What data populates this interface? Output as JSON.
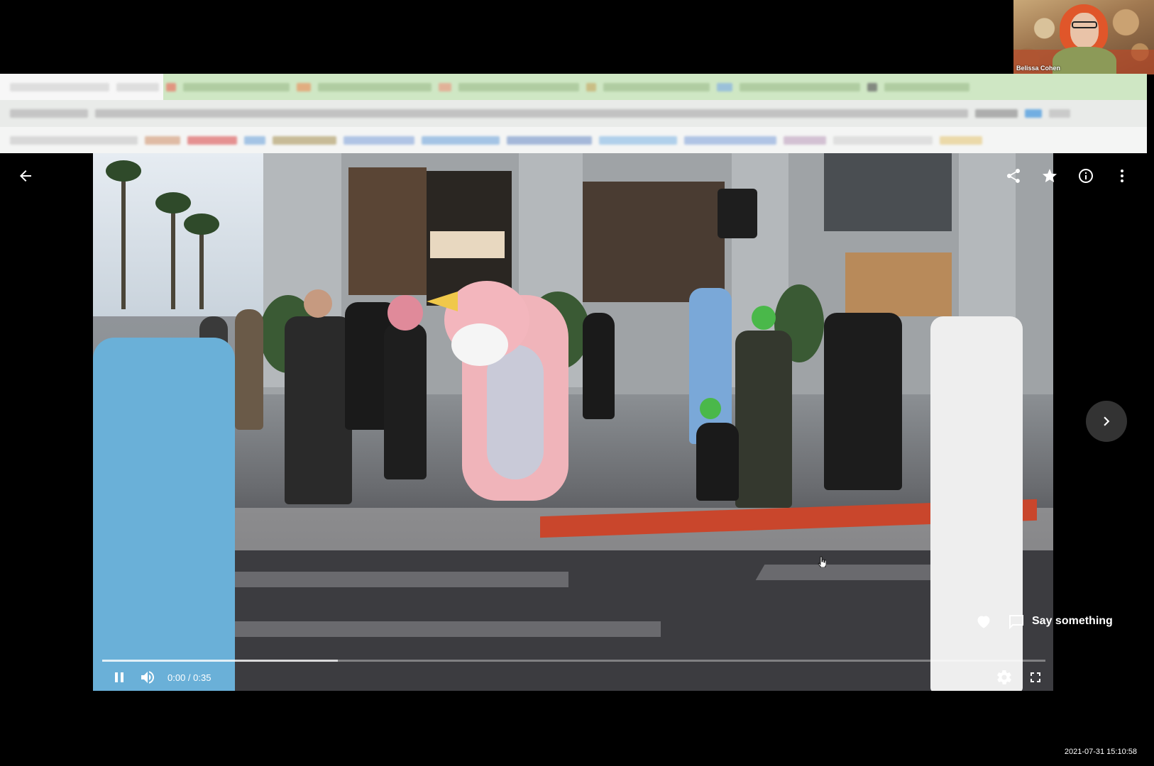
{
  "webcam": {
    "participant_name": "Belissa Cohen"
  },
  "top_bar": {
    "back_icon": "arrow-left-icon",
    "share_icon": "share-icon",
    "favorite_icon": "star-icon",
    "info_icon": "info-icon",
    "more_icon": "more-vertical-icon"
  },
  "navigation": {
    "next_icon": "chevron-right-icon"
  },
  "comments": {
    "like_icon": "heart-icon",
    "say_label": "Say something"
  },
  "player": {
    "current_time": "0:00",
    "duration": "0:35",
    "time_display": "0:00 / 0:35",
    "played_fraction": 0.0,
    "buffered_fraction": 0.25,
    "pause_icon": "pause-icon",
    "volume_icon": "volume-icon",
    "settings_icon": "gear-icon",
    "fullscreen_icon": "fullscreen-icon"
  },
  "screen_timestamp": "2021-07-31  15:10:58"
}
